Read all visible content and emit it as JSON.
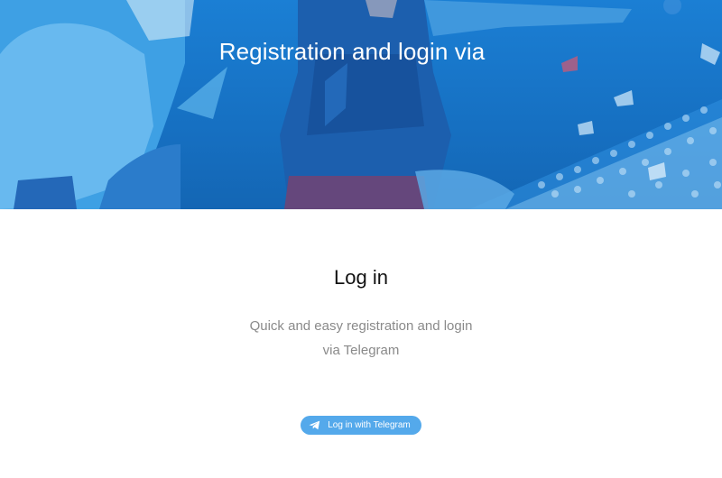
{
  "hero": {
    "title": "Registration and login via"
  },
  "login": {
    "title": "Log in",
    "description_line1": "Quick and easy registration and login",
    "description_line2": "via Telegram",
    "button_label": "Log in with Telegram",
    "button_icon": "telegram-plane-icon"
  },
  "colors": {
    "hero_blue": "#1670c2",
    "button_blue": "#54a9eb",
    "description_gray": "#8a8a8a"
  }
}
